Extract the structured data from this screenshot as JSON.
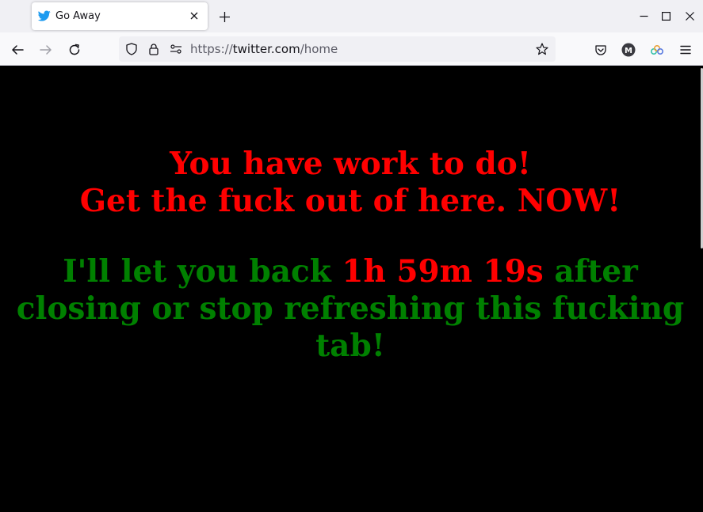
{
  "browser": {
    "tab": {
      "title": "Go Away",
      "favicon": "twitter-bird-icon"
    },
    "url": {
      "scheme": "https://",
      "host": "twitter.com",
      "path": "/home"
    },
    "colors": {
      "twitter_blue": "#1d9bf0"
    }
  },
  "page": {
    "line1": "You have work to do!",
    "line2": "Get the fuck out of here. NOW!",
    "message_before": "I'll let you back ",
    "countdown": "1h 59m 19s",
    "message_after": " after closing or stop refreshing this fucking tab!",
    "colors": {
      "background": "#000000",
      "warning": "#ff0000",
      "message": "#008000"
    }
  }
}
